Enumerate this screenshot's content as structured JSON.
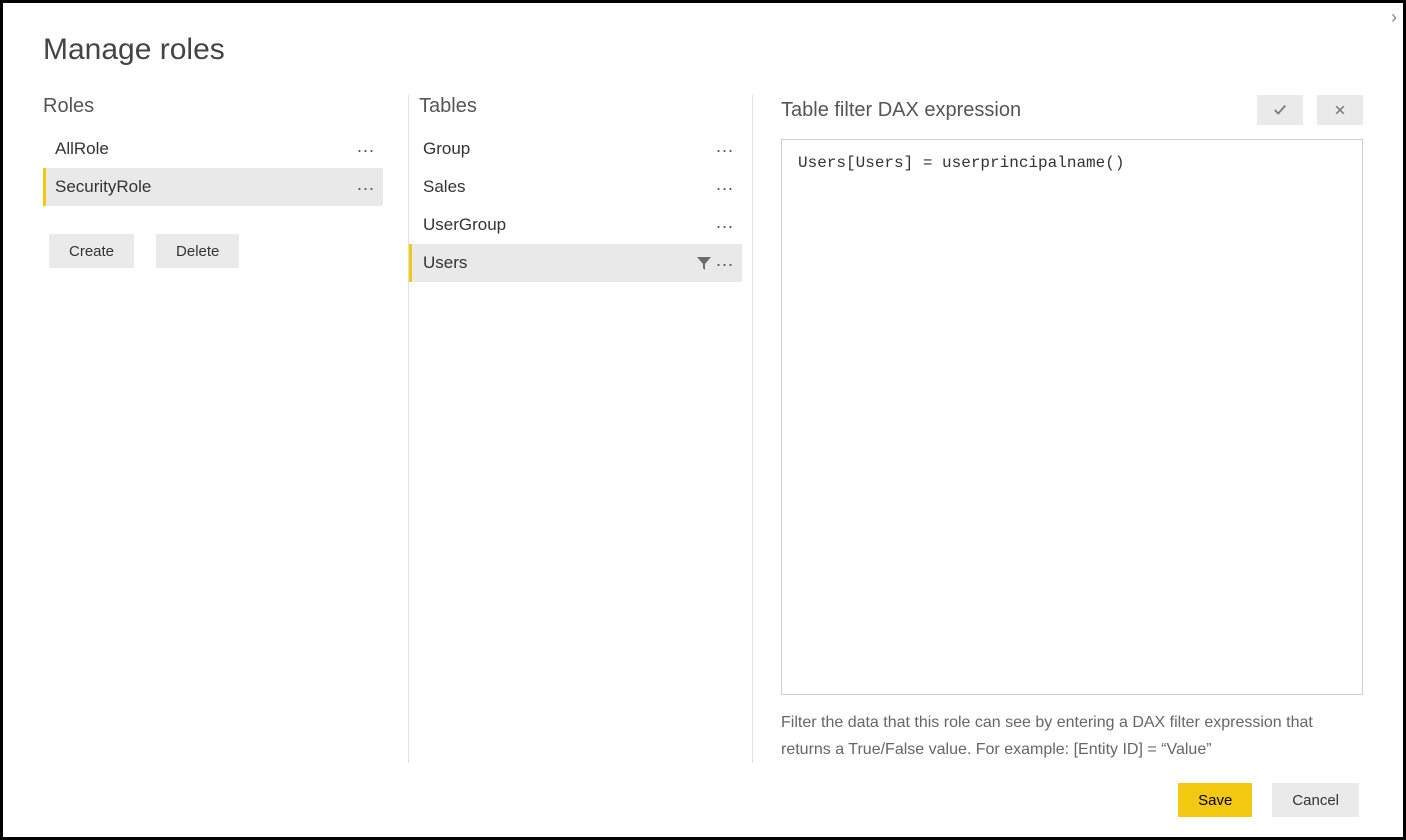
{
  "dialog": {
    "title": "Manage roles"
  },
  "roles": {
    "header": "Roles",
    "items": [
      {
        "label": "AllRole",
        "selected": false
      },
      {
        "label": "SecurityRole",
        "selected": true
      }
    ],
    "create_label": "Create",
    "delete_label": "Delete"
  },
  "tables": {
    "header": "Tables",
    "items": [
      {
        "label": "Group",
        "selected": false,
        "filtered": false
      },
      {
        "label": "Sales",
        "selected": false,
        "filtered": false
      },
      {
        "label": "UserGroup",
        "selected": false,
        "filtered": false
      },
      {
        "label": "Users",
        "selected": true,
        "filtered": true
      }
    ]
  },
  "dax": {
    "header": "Table filter DAX expression",
    "expression": "Users[Users] = userprincipalname()",
    "help_text": "Filter the data that this role can see by entering a DAX filter expression that returns a True/False value. For example: [Entity ID] = “Value”"
  },
  "footer": {
    "save_label": "Save",
    "cancel_label": "Cancel"
  }
}
